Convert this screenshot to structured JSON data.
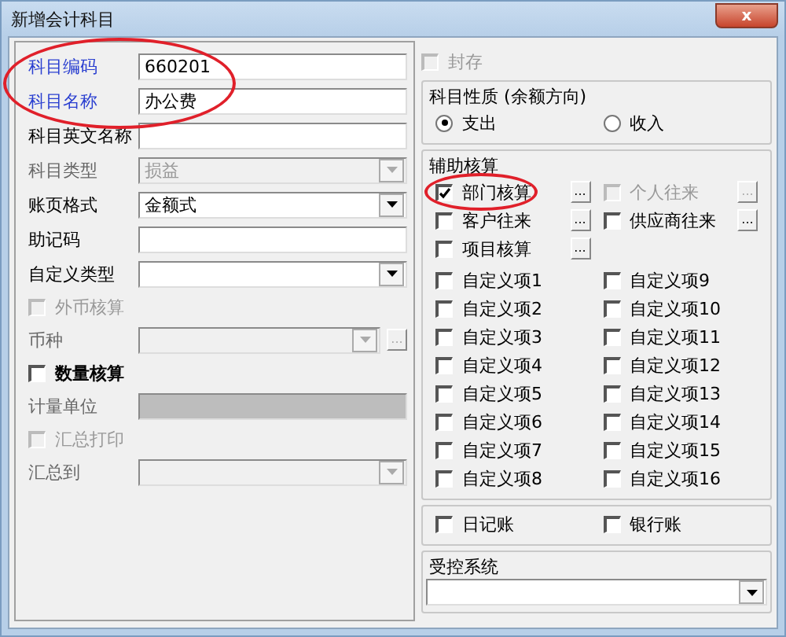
{
  "window": {
    "title": "新增会计科目",
    "close_label": "x"
  },
  "left_rows": [
    {
      "kind": "text",
      "label": "科目编码",
      "value": "660201",
      "highlight": true
    },
    {
      "kind": "text",
      "label": "科目名称",
      "value": "办公费",
      "highlight": true
    },
    {
      "kind": "text",
      "label": "科目英文名称",
      "highlight": false
    },
    {
      "kind": "select",
      "label": "科目类型",
      "value": "损益",
      "highlight": false,
      "disabled": true
    },
    {
      "kind": "select",
      "label": "账页格式",
      "value": "金额式",
      "highlight": false,
      "disabled": false
    },
    {
      "kind": "text",
      "label": "助记码",
      "highlight": false
    },
    {
      "kind": "select",
      "label": "自定义类型",
      "highlight": false,
      "disabled": false
    },
    {
      "kind": "checkbox",
      "label": "外币核算",
      "checked": false,
      "disabled": true
    },
    {
      "kind": "select",
      "label": "币种",
      "highlight": false,
      "disabled": true,
      "more": "..."
    },
    {
      "kind": "checkbox",
      "label": "数量核算",
      "checked": false,
      "disabled": false
    },
    {
      "kind": "unit",
      "label": "计量单位",
      "highlight": false,
      "disabled": true
    },
    {
      "kind": "checkbox",
      "label": "汇总打印",
      "checked": false,
      "disabled": true
    },
    {
      "kind": "select",
      "label": "汇总到",
      "highlight": false,
      "disabled": true
    }
  ],
  "seal": {
    "label": "封存",
    "checked": false,
    "disabled": true
  },
  "direction": {
    "title": "科目性质 (余额方向)",
    "options": [
      {
        "label": "支出",
        "selected": true
      },
      {
        "label": "收入",
        "selected": false
      }
    ]
  },
  "auxiliary": {
    "title": "辅助核算",
    "items": [
      {
        "label": "部门核算",
        "checked": true,
        "disabled": false,
        "more": "..."
      },
      {
        "label": "个人往来",
        "checked": false,
        "disabled": true,
        "more": "..."
      },
      {
        "label": "客户往来",
        "checked": false,
        "disabled": false,
        "more": "..."
      },
      {
        "label": "供应商往来",
        "checked": false,
        "disabled": false,
        "more": "..."
      },
      {
        "label": "项目核算",
        "checked": false,
        "disabled": false,
        "more": "..."
      }
    ],
    "custom": [
      {
        "label": "自定义项1",
        "checked": false
      },
      {
        "label": "自定义项2",
        "checked": false
      },
      {
        "label": "自定义项3",
        "checked": false
      },
      {
        "label": "自定义项4",
        "checked": false
      },
      {
        "label": "自定义项5",
        "checked": false
      },
      {
        "label": "自定义项6",
        "checked": false
      },
      {
        "label": "自定义项7",
        "checked": false
      },
      {
        "label": "自定义项8",
        "checked": false
      },
      {
        "label": "自定义项9",
        "checked": false
      },
      {
        "label": "自定义项10",
        "checked": false
      },
      {
        "label": "自定义项11",
        "checked": false
      },
      {
        "label": "自定义项12",
        "checked": false
      },
      {
        "label": "自定义项13",
        "checked": false
      },
      {
        "label": "自定义项14",
        "checked": false
      },
      {
        "label": "自定义项15",
        "checked": false
      },
      {
        "label": "自定义项16",
        "checked": false
      }
    ]
  },
  "books": [
    {
      "label": "日记账",
      "checked": false
    },
    {
      "label": "银行账",
      "checked": false
    }
  ],
  "controlled": {
    "title": "受控系统"
  }
}
